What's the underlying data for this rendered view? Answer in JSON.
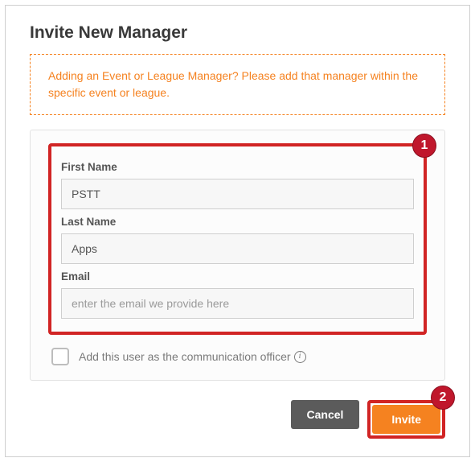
{
  "modal": {
    "title": "Invite New Manager",
    "banner": "Adding an Event or League Manager? Please add that manager within the specific event or league."
  },
  "form": {
    "first_name_label": "First Name",
    "first_name_value": "PSTT",
    "last_name_label": "Last Name",
    "last_name_value": "Apps",
    "email_label": "Email",
    "email_placeholder": "enter the email we provide here",
    "checkbox_label": "Add this user as the communication officer"
  },
  "buttons": {
    "cancel": "Cancel",
    "invite": "Invite"
  },
  "callouts": {
    "one": "1",
    "two": "2"
  }
}
